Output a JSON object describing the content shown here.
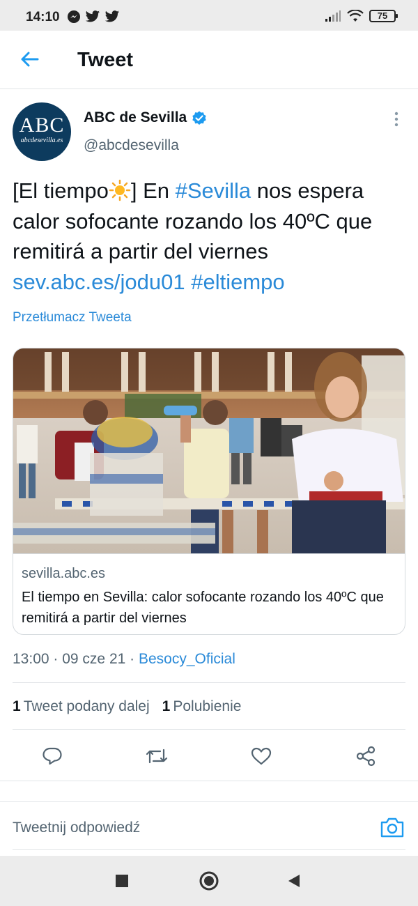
{
  "status_bar": {
    "time": "14:10",
    "battery": "75",
    "left_icons": [
      "messenger-icon",
      "twitter-icon",
      "twitter-icon"
    ],
    "right_icons": [
      "signal-icon",
      "wifi-icon",
      "battery-icon"
    ]
  },
  "app_bar": {
    "title": "Tweet",
    "back_icon": "arrow-left-icon"
  },
  "tweet": {
    "avatar_text": "ABC",
    "avatar_subtext": "abcdesevilla.es",
    "author_name": "ABC de Sevilla",
    "handle": "@abcdesevilla",
    "text_parts": {
      "p1": "[El tiempo",
      "p2": "] En ",
      "p3": "#Sevilla",
      "p4": " nos espera calor sofocante rozando los 40ºC que remitirá a partir del viernes ",
      "p5": "sev.abc.es/jodu01",
      "p6": " ",
      "p7": "#eltiempo"
    },
    "translate_label": "Przetłumacz Tweeta",
    "card": {
      "domain": "sevilla.abc.es",
      "title": "El tiempo en Sevilla: calor sofocante rozando los 40ºC que remitirá a partir del viernes"
    },
    "meta": {
      "time": "13:00",
      "date": "09 cze 21",
      "source": "Besocy_Oficial",
      "separator": " · "
    },
    "stats": {
      "retweets_count": "1",
      "retweets_label": "Tweet podany dalej",
      "likes_count": "1",
      "likes_label": "Polubienie"
    }
  },
  "reply": {
    "placeholder": "Tweetnij odpowiedź"
  },
  "colors": {
    "link": "#2a8ad8",
    "verified": "#1d9bf0",
    "secondary_text": "#536471",
    "avatar_bg": "#0d3b5e"
  }
}
